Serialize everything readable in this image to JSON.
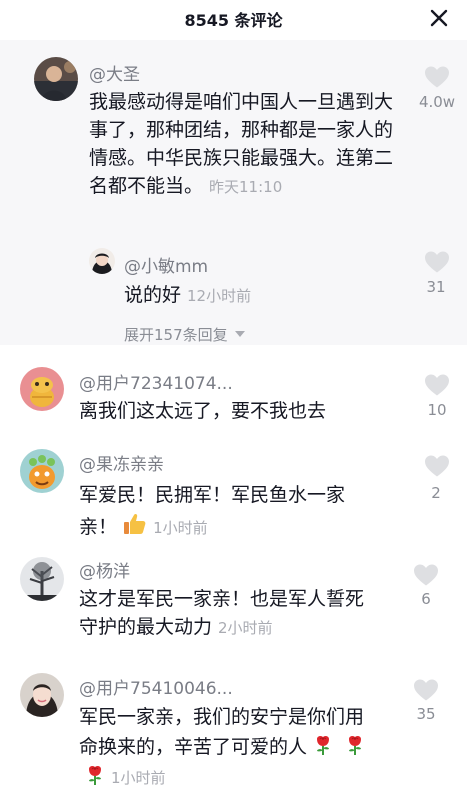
{
  "header": {
    "title": "8545 条评论"
  },
  "comments": [
    {
      "user": "@大圣",
      "text": "我最感动得是咱们中国人一旦遇到大事了，那种团结，那种都是一家人的情感。中华民族只能最强大。连第二名都不能当。",
      "time": "昨天11:10",
      "likes": "4.0w",
      "reply": {
        "user": "@小敏mm",
        "text": "说的好",
        "time": "12小时前",
        "likes": "31"
      },
      "expand": "展开157条回复"
    },
    {
      "user": "@用户72341074...",
      "text": "离我们这太远了，要不我也去",
      "time": "",
      "likes": "10"
    },
    {
      "user": "@果冻亲亲",
      "text": "军爱民！民拥军！军民鱼水一家亲！",
      "time": "1小时前",
      "likes": "2"
    },
    {
      "user": "@杨洋",
      "text": "这才是军民一家亲！也是军人誓死守护的最大动力",
      "time": "2小时前",
      "likes": "6"
    },
    {
      "user": "@用户75410046...",
      "text": "军民一家亲，我们的安宁是你们用命换来的，辛苦了可爱的人",
      "time": "1小时前",
      "likes": "35"
    }
  ],
  "colors": {
    "text": "#161823",
    "secondary": "#7a7d86",
    "heart": "#dedfe2"
  },
  "icons": [
    "close-icon",
    "heart-icon",
    "chevron-down-icon",
    "thumbs-up-emoji",
    "rose-emoji"
  ]
}
